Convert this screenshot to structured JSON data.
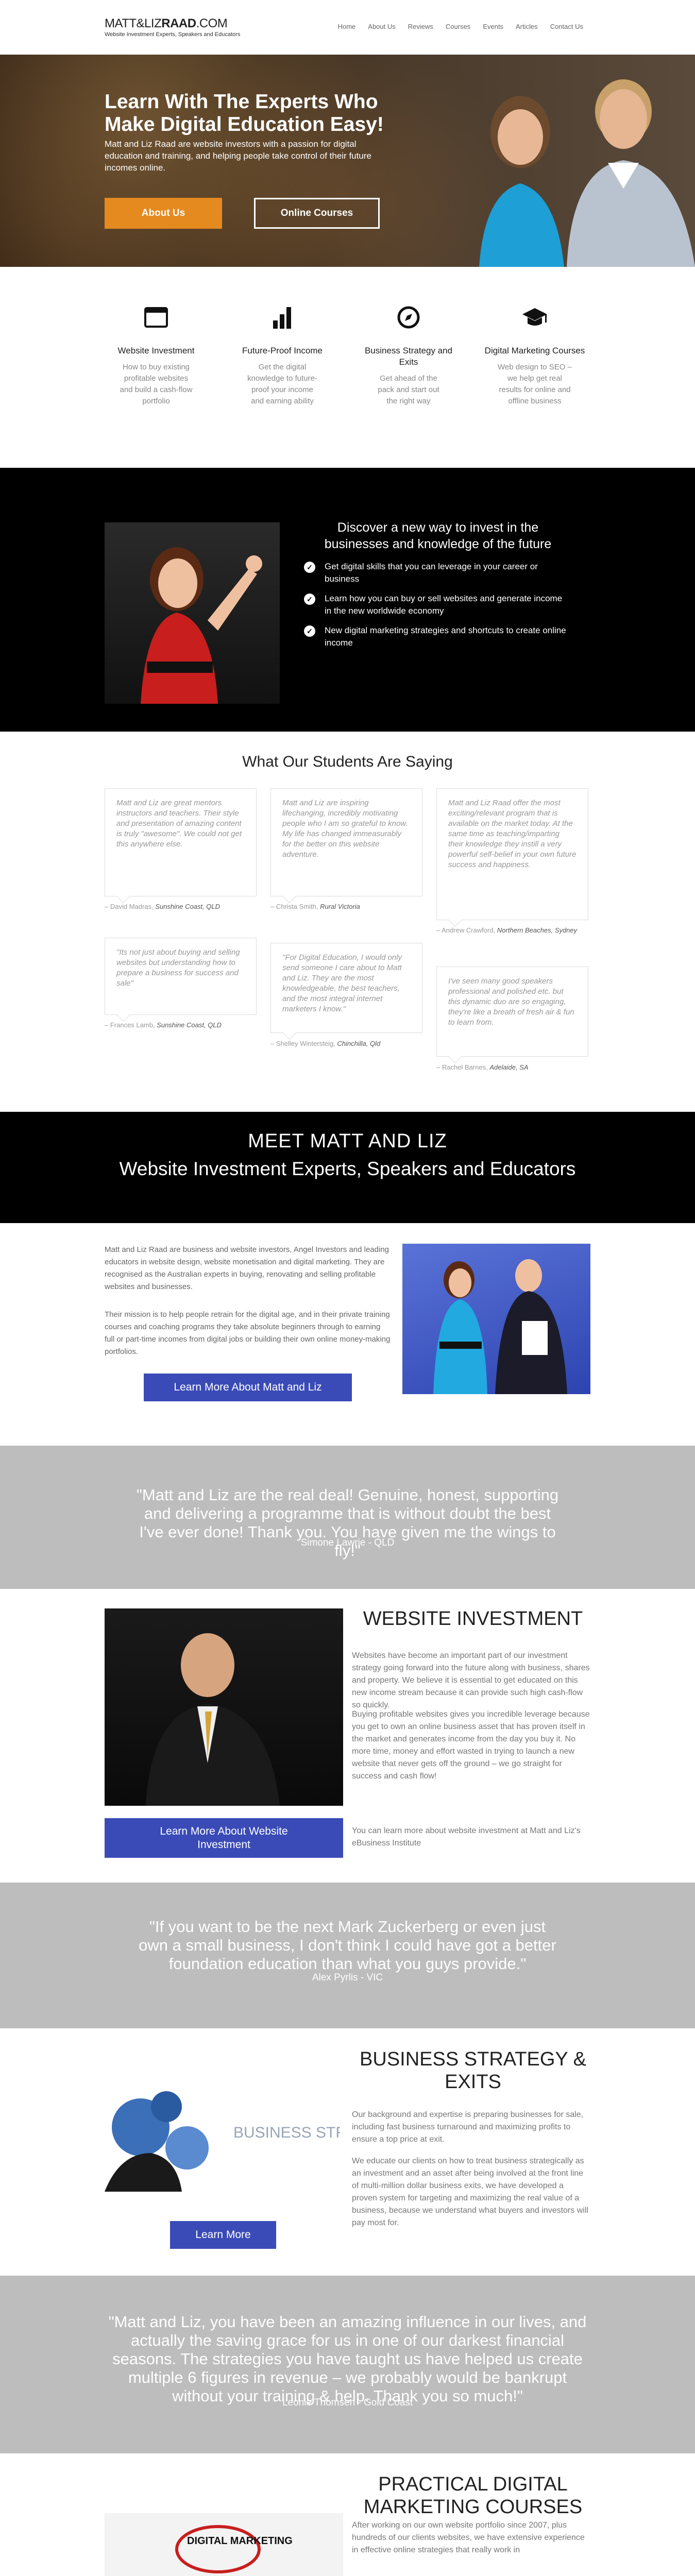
{
  "header": {
    "logo_main": "MATT&LIZ",
    "logo_bold": "RAAD",
    "logo_suffix": ".COM",
    "logo_tagline": "Website Investment Experts, Speakers and Educators",
    "nav": [
      "Home",
      "About Us",
      "Reviews",
      "Courses",
      "Events",
      "Articles",
      "Contact Us"
    ]
  },
  "hero": {
    "title": "Learn With The Experts Who Make Digital Education Easy!",
    "text": "Matt and Liz Raad are website investors with a passion for digital education and training, and helping people take control of their future incomes online.",
    "btn_about": "About Us",
    "btn_courses": "Online Courses",
    "colors": {
      "accent": "#e58a1f"
    }
  },
  "features": [
    {
      "icon": "browser-icon",
      "title": "Website Investment",
      "text": "How to buy existing profitable websites and build a cash-flow portfolio"
    },
    {
      "icon": "bar-chart-icon",
      "title": "Future-Proof Income",
      "text": "Get the digital knowledge to future-proof your income and earning ability"
    },
    {
      "icon": "compass-icon",
      "title": "Business Strategy and Exits",
      "text": "Get ahead of the pack and start out the right way"
    },
    {
      "icon": "graduation-cap-icon",
      "title": "Digital Marketing Courses",
      "text": "Web design to SEO – we help get real results for online and offline business"
    }
  ],
  "discover": {
    "title": "Discover a new way to invest in the businesses and knowledge of the future",
    "items": [
      "Get digital skills that you can leverage in your career or business",
      "Learn how you can buy or sell websites and generate income in the new worldwide economy",
      "New digital marketing strategies and shortcuts to create online income"
    ]
  },
  "testimonials": {
    "title": "What Our Students Are Saying",
    "cards": [
      {
        "text": "Matt and Liz are great mentors instructors and teachers. Their style and presentation of amazing content is truly \"awesome\". We could not get this anywhere else.",
        "author": "– David Madras,",
        "place": "Sunshine Coast, QLD"
      },
      {
        "text": "Matt and Liz are inspiring lifechanging, incredibly motivating people who I am so grateful to know. My life has changed immeasurably for the better on this website adventure.",
        "author": "– Christa Smith,",
        "place": "Rural Victoria"
      },
      {
        "text": "Matt and Liz Raad offer the most exciting/relevant program that is available on the market today. At the same time as teaching/imparting their knowledge they instill a very powerful self-belief in your own future success and happiness.",
        "author": "– Andrew Crawford,",
        "place": "Northern Beaches, Sydney"
      },
      {
        "text": "\"Its not just about buying and selling websites but understanding how to prepare a business for success and sale\"",
        "author": "– Frances Lamb,",
        "place": "Sunshine Coast, QLD"
      },
      {
        "text": "\"For Digital Education, I would only send someone I care about to Matt and Liz. They are the most knowledgeable, the best teachers, and the most integral internet marketers I know.\"",
        "author": "– Shelley Wintersteig,",
        "place": "Chinchilla, Qld"
      },
      {
        "text": "I've seen many good speakers professional and polished etc. but this dynamic duo are so engaging, they're like a breath of fresh air & fun to learn from.",
        "author": "– Rachel Barnes,",
        "place": "Adelaide, SA"
      }
    ]
  },
  "meet": {
    "title": "MEET MATT AND LIZ",
    "subtitle": "Website Investment Experts, Speakers and Educators"
  },
  "about": {
    "p1": "Matt and Liz Raad are business and website investors, Angel Investors and leading educators in website design, website monetisation and digital marketing. They are recognised as the Australian experts in buying, renovating and selling profitable websites and businesses.",
    "p2": "Their mission is to help people retrain for the digital age, and in their private training courses and coaching programs they take absolute beginners through to earning full or part-time incomes from digital jobs or building their own online money-making portfolios.",
    "btn": "Learn More About Matt and Liz"
  },
  "quote1": {
    "text": "\"Matt and Liz are the real deal! Genuine, honest, supporting and delivering a programme that is without doubt the best I've ever done! Thank you. You have given me the wings to fly!\"",
    "author": "Simone Lawrie - QLD"
  },
  "website_investment": {
    "title": "WEBSITE INVESTMENT",
    "p1": "Websites have become an important part of our investment strategy going forward into the future along with business, shares and property. We believe it is essential to get educated on this new income stream because it can provide such high cash-flow so quickly.",
    "p2": "Buying profitable websites gives you incredible leverage because you get to own an online business asset that has proven itself in the market and generates income from the day you buy it. No more time, money and effort wasted in trying to launch a new website that never gets off the ground – we go straight for success and cash flow!",
    "p3": "You can learn more about website investment at Matt and Liz's eBusiness Institute",
    "btn": "Learn More About Website Investment"
  },
  "quote2": {
    "text": "\"If you want to be the next Mark Zuckerberg or even just own a small business, I don't think I could have got a better foundation education than what you guys provide.\"",
    "author": "Alex Pyrlis - VIC"
  },
  "business_strategy": {
    "title": "BUSINESS STRATEGY & EXITS",
    "p1": "Our background and expertise is preparing businesses for sale, including fast business turnaround and maximizing profits to ensure a top price at exit.",
    "p2": "We educate our clients on how to treat business strategically as an investment and an asset after being involved at the front line of multi-million dollar business exits, we have developed a proven system for targeting and maximizing the real value of a business, because we understand what buyers and investors will pay most for.",
    "btn": "Learn More",
    "img_text": "BUSINESS STRATEGY"
  },
  "quote3": {
    "text": "\"Matt and Liz, you have been an amazing influence in our lives, and actually the saving grace for us in one of our darkest financial seasons. The strategies you have taught us have helped us create multiple 6 figures in revenue – we probably would be bankrupt without your training & help. Thank you so much!\"",
    "author": "Leonie Thomsen - Gold Coast"
  },
  "pdm": {
    "title": "PRACTICAL DIGITAL MARKETING COURSES",
    "p1": "After working on our own website portfolio since 2007, plus hundreds of our clients websites, we have extensive experience in effective online strategies that really work in",
    "img_text": "DIGITAL MARKETING"
  }
}
